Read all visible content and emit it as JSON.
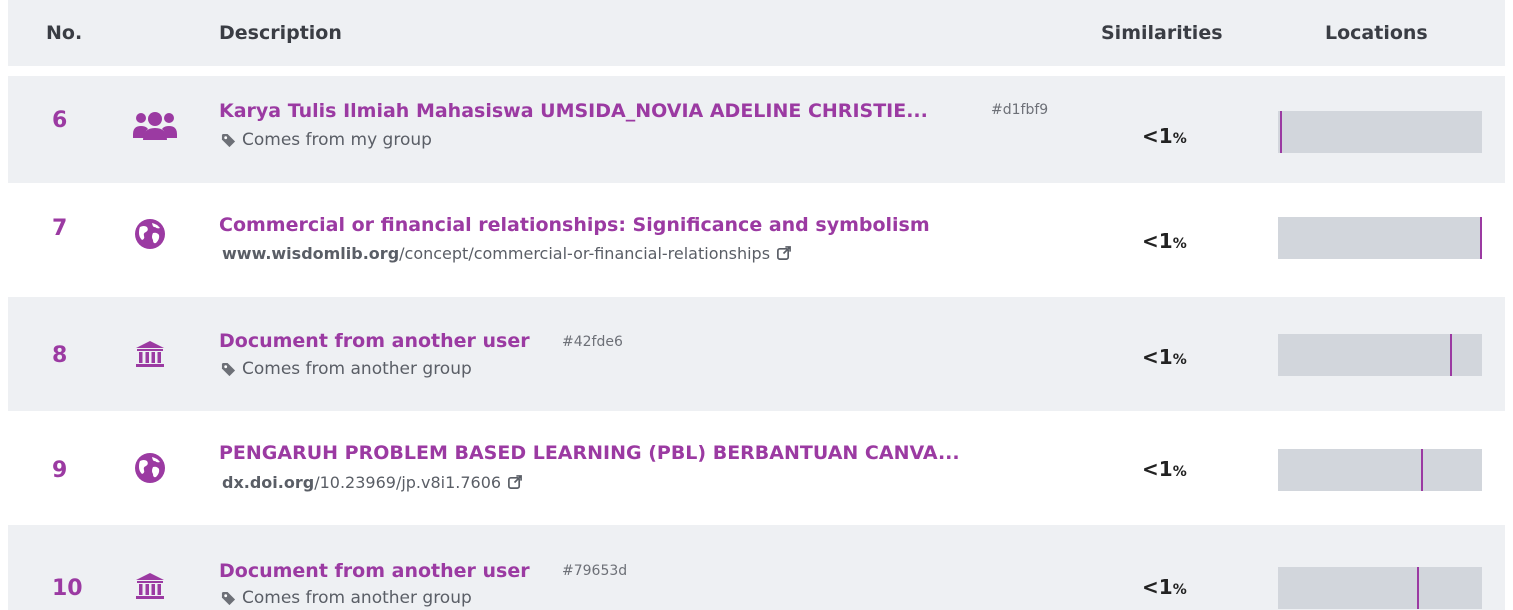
{
  "header": {
    "no": "No.",
    "description": "Description",
    "similarities": "Similarities",
    "locations": "Locations"
  },
  "rows": [
    {
      "no": "6",
      "icon": "group-icon",
      "title": "Karya Tulis Ilmiah Mahasiswa UMSIDA_NOVIA ADELINE CHRISTIE...",
      "hash": "#d1fbf9",
      "sub": "Comes from my group",
      "similarity": "<1",
      "percent": "%",
      "location_fraction": 0.01
    },
    {
      "no": "7",
      "icon": "globe-icon",
      "title": "Commercial or financial relationships: Significance and symbolism",
      "link_domain": "www.wisdomlib.org",
      "link_path": "/concept/commercial-or-financial-relationships",
      "similarity": "<1",
      "percent": "%",
      "location_fraction": 0.99
    },
    {
      "no": "8",
      "icon": "institution-icon",
      "title": "Document from another user",
      "hash": "#42fde6",
      "sub": "Comes from another group",
      "similarity": "<1",
      "percent": "%",
      "location_fraction": 0.845
    },
    {
      "no": "9",
      "icon": "globe-icon",
      "title": "PENGARUH PROBLEM BASED LEARNING (PBL) BERBANTUAN CANVA...",
      "link_domain": "dx.doi.org",
      "link_path": "/10.23969/jp.v8i1.7606",
      "similarity": "<1",
      "percent": "%",
      "location_fraction": 0.7
    },
    {
      "no": "10",
      "icon": "institution-icon",
      "title": "Document from another user",
      "hash": "#79653d",
      "sub": "Comes from another group",
      "similarity": "<1",
      "percent": "%",
      "location_fraction": 0.68
    }
  ],
  "colors": {
    "accent": "#9b3aa2",
    "row_alt": "#eef0f3",
    "bar": "#d2d6dc"
  }
}
